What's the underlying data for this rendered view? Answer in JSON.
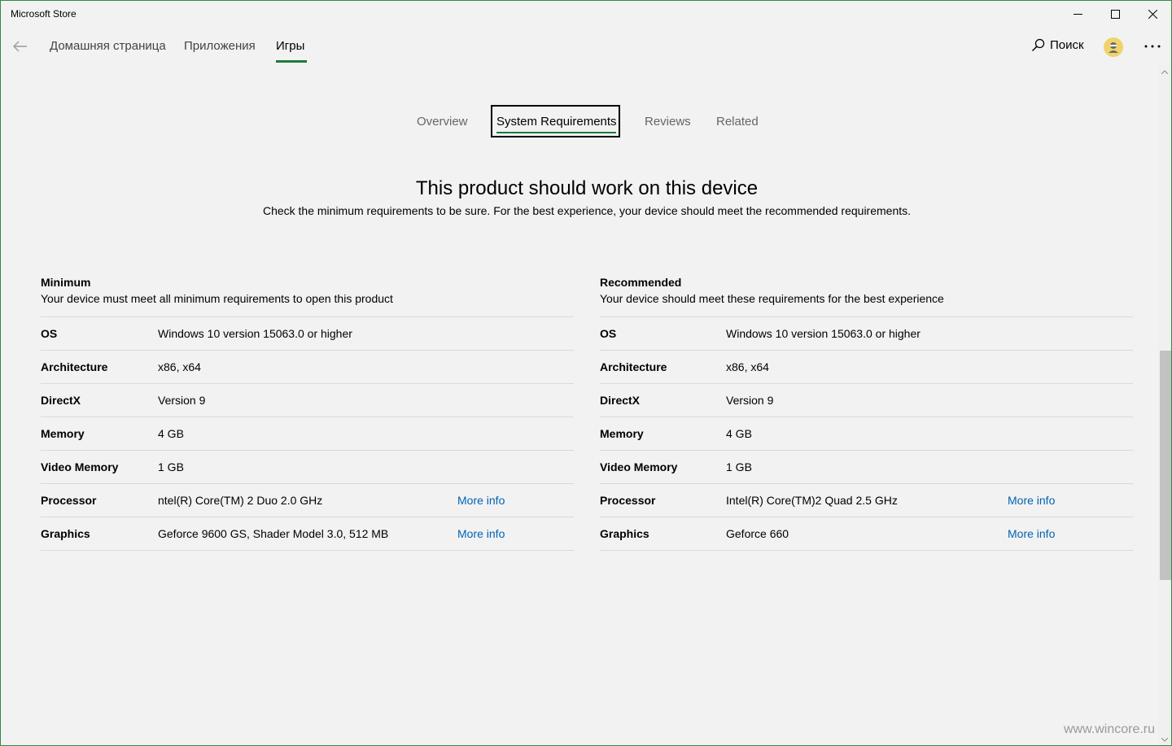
{
  "window": {
    "title": "Microsoft Store"
  },
  "nav": {
    "home": "Домашняя страница",
    "apps": "Приложения",
    "games": "Игры",
    "search": "Поиск"
  },
  "tabs": {
    "overview": "Overview",
    "system_requirements": "System Requirements",
    "reviews": "Reviews",
    "related": "Related",
    "active": "System Requirements"
  },
  "headline": "This product should work on this device",
  "subline": "Check the minimum requirements to be sure. For the best experience, your device should meet the recommended requirements.",
  "minimum": {
    "title": "Minimum",
    "description": "Your device must meet all minimum requirements to open this product",
    "rows": [
      {
        "label": "OS",
        "value": "Windows 10 version 15063.0 or higher"
      },
      {
        "label": "Architecture",
        "value": "x86, x64"
      },
      {
        "label": "DirectX",
        "value": "Version 9"
      },
      {
        "label": "Memory",
        "value": "4 GB"
      },
      {
        "label": "Video Memory",
        "value": "1 GB"
      },
      {
        "label": "Processor",
        "value": "ntel(R) Core(TM) 2 Duo 2.0 GHz",
        "link": "More info"
      },
      {
        "label": "Graphics",
        "value": "Geforce 9600 GS, Shader Model 3.0, 512 MB",
        "link": "More info"
      }
    ]
  },
  "recommended": {
    "title": "Recommended",
    "description": "Your device should meet these requirements for the best experience",
    "rows": [
      {
        "label": "OS",
        "value": "Windows 10 version 15063.0 or higher"
      },
      {
        "label": "Architecture",
        "value": "x86, x64"
      },
      {
        "label": "DirectX",
        "value": "Version 9"
      },
      {
        "label": "Memory",
        "value": "4 GB"
      },
      {
        "label": "Video Memory",
        "value": "1 GB"
      },
      {
        "label": "Processor",
        "value": "Intel(R) Core(TM)2 Quad 2.5 GHz",
        "link": "More info"
      },
      {
        "label": "Graphics",
        "value": "Geforce 660",
        "link": "More info"
      }
    ]
  },
  "watermark": "www.wincore.ru",
  "colors": {
    "accent": "#1e7a3a",
    "link": "#0063b1",
    "window_border": "#2e8b3e",
    "background": "#f2f2f2"
  }
}
